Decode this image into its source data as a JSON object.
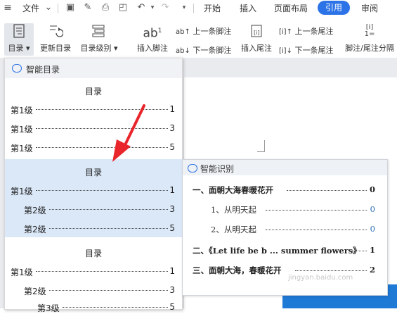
{
  "menubar": {
    "file_label": "文件",
    "tabs": [
      "开始",
      "插入",
      "页面布局",
      "引用",
      "审阅"
    ],
    "active_tab": "引用"
  },
  "ribbon": {
    "toc_label": "目录",
    "update_toc_label": "更新目录",
    "toc_level_label": "目录级别",
    "insert_footnote_label": "插入脚注",
    "prev_footnote_label": "上一条脚注",
    "next_footnote_label": "下一条脚注",
    "insert_endnote_label": "插入尾注",
    "prev_endnote_label": "上一条尾注",
    "next_endnote_label": "下一条尾注",
    "separator_label": "脚注/尾注分隔"
  },
  "toc_panel": {
    "header": "智能目录",
    "templates": [
      {
        "title": "目录",
        "lines": [
          {
            "label": "第1级",
            "page": "1"
          },
          {
            "label": "第1级",
            "page": "3"
          },
          {
            "label": "第1级",
            "page": "5"
          }
        ]
      },
      {
        "title": "目录",
        "lines": [
          {
            "label": "第1级",
            "page": "1"
          },
          {
            "label": "第2级",
            "page": "3"
          },
          {
            "label": "第2级",
            "page": "5"
          }
        ]
      },
      {
        "title": "目录",
        "lines": [
          {
            "label": "第1级",
            "page": "1"
          },
          {
            "label": "第2级",
            "page": "3"
          },
          {
            "label": "第3级",
            "page": "5"
          }
        ]
      }
    ]
  },
  "smart_panel": {
    "header": "智能识别",
    "lines": [
      {
        "label": "一、面朝大海春暖花开",
        "page": "0"
      },
      {
        "label": "1、从明天起",
        "page": "0"
      },
      {
        "label": "2、从明天起",
        "page": "0"
      },
      {
        "label": "二、《Let life be b ... summer flowers》",
        "page": "1"
      },
      {
        "label": "三、面朝大海，春暖花开",
        "page": "2"
      }
    ]
  },
  "watermark": "jingyan.baidu.com",
  "colors": {
    "accent": "#2b73e6",
    "highlight": "#dbe8f8",
    "arrow": "#e8262b"
  }
}
